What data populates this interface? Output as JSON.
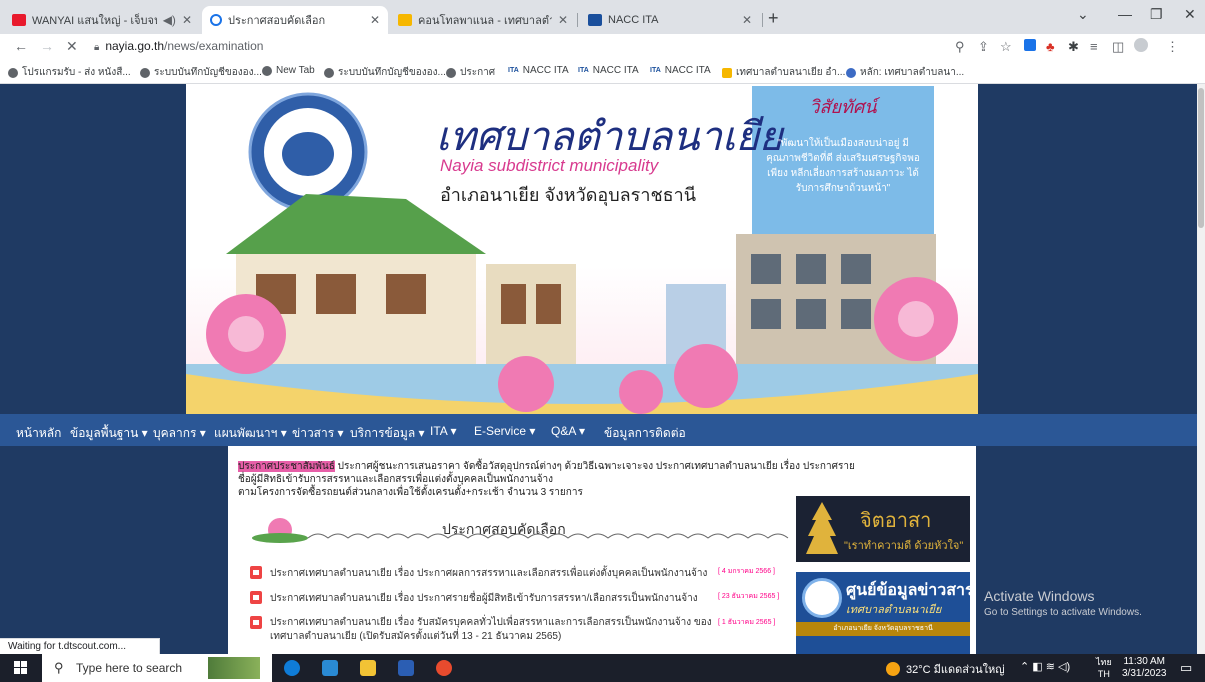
{
  "browser": {
    "tabs": [
      {
        "title": "WANYAI แสนใหญ่ - เจ็บจนพอ |",
        "active": false,
        "favicon_color": "#e8192c"
      },
      {
        "title": "ประกาศสอบคัดเลือก",
        "active": true,
        "favicon_color": "#1a73e8"
      },
      {
        "title": "คอนโทลพาแนล - เทศบาลตำบลนาเยีย",
        "active": false,
        "favicon_color": "#f6b700"
      },
      {
        "title": "NACC ITA",
        "active": false,
        "favicon_color": "#1a4f9c"
      }
    ],
    "url_host": "nayia.go.th",
    "url_path": "/news/examination",
    "bookmarks": [
      "โปรแกรมรับ - ส่ง หนังสื...",
      "ระบบบันทึกบัญชีขององ...",
      "New Tab",
      "ระบบบันทึกบัญชีขององ...",
      "ประกาศ",
      "NACC ITA",
      "NACC ITA",
      "NACC ITA",
      "เทศบาลตำบลนาเยีย อำ...",
      "หลัก: เทศบาลตำบลนา..."
    ],
    "ita_badge": "ITA",
    "status_text": "Waiting for t.dtscout.com..."
  },
  "banner": {
    "title_th": "เทศบาลตำบลนาเยีย",
    "title_en": "Nayia subdistrict municipality",
    "district": "อำเภอนาเยีย จังหวัดอุบลราชธานี",
    "vision_title": "วิสัยทัศน์",
    "vision_text": "\"พัฒนาให้เป็นเมืองสงบน่าอยู่ มีคุณภาพชีวิตที่ดี ส่งเสริมเศรษฐกิจพอเพียง หลีกเลี่ยงการสร้างมลภาวะ ได้รับการศึกษาถ้วนหน้า\""
  },
  "nav": {
    "items": [
      "หน้าหลัก",
      "ข้อมูลพื้นฐาน ▾",
      "บุคลากร ▾",
      "แผนพัฒนาฯ ▾",
      "ข่าวสาร ▾",
      "บริการข้อมูล ▾",
      "ITA ▾",
      "E-Service ▾",
      "Q&A ▾",
      "ข้อมูลการติดต่อ"
    ]
  },
  "content": {
    "marquee_highlight": "ประกาศประชาสัมพันธ์",
    "marquee_text": "ประกาศผู้ชนะการเสนอราคา จัดซื้อวัสดุอุปกรณ์ต่างๆ ด้วยวิธีเฉพาะเจาะจง ประกาศเทศบาลตำบลนาเยีย เรื่อง ประกาศรายชื่อผู้มีสิทธิเข้ารับการสรรหาและเลือกสรรเพื่อแต่งตั้งบุคคลเป็นพนักงานจ้าง",
    "marquee_line2": "ตามโครงการจัดซื้อรถยนต์ส่วนกลางเพื่อใช้ตั้งเครนตั้ง+กระเช้า จำนวน 3 รายการ",
    "section_title": "ประกาศสอบคัดเลือก",
    "documents": [
      {
        "title": "ประกาศเทศบาลตำบลนาเยีย เรื่อง ประกาศผลการสรรหาและเลือกสรรเพื่อแต่งตั้งบุคคลเป็นพนักงานจ้าง",
        "date": "[ 4 มกราคม 2566 ]"
      },
      {
        "title": "ประกาศเทศบาลตำบลนาเยีย เรื่อง ประกาศรายชื่อผู้มีสิทธิเข้ารับการสรรหา/เลือกสรรเป็นพนักงานจ้าง",
        "date": "[ 23 ธันวาคม 2565 ]"
      },
      {
        "title": "ประกาศเทศบาลตำบลนาเยีย เรื่อง รับสมัครบุคคลทั่วไปเพื่อสรรหาและการเลือกสรรเป็นพนักงานจ้าง ของ",
        "date": "[ 1 ธันวาคม 2565 ]"
      }
    ],
    "doc3_line2": "เทศบาลตำบลนาเยีย (เปิดรับสมัครตั้งแต่วันที่ 13 - 21 ธันวาคม 2565)",
    "side_card1_title": "จิตอาสา",
    "side_card1_sub": "\"เราทำความดี ด้วยหัวใจ\"",
    "side_card2_title": "ศูนย์ข้อมูลข่าวสาร",
    "side_card2_sub": "เทศบาลตำบลนาเยีย",
    "side_card2_foot": "อำเภอนาเยีย จังหวัดอุบลราชธานี"
  },
  "activation": {
    "title": "Activate Windows",
    "sub": "Go to Settings to activate Windows."
  },
  "taskbar": {
    "search_placeholder": "Type here to search",
    "weather": "32°C มีแดดส่วนใหญ่",
    "lang_top": "ไทย",
    "lang_bottom": "TH",
    "time": "11:30 AM",
    "date": "3/31/2023"
  }
}
